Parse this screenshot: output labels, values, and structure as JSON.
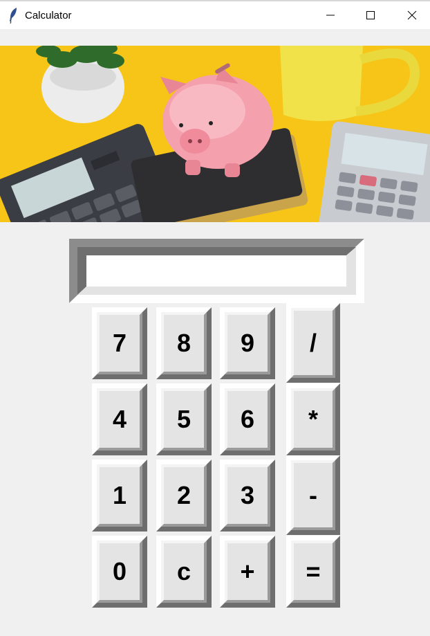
{
  "window": {
    "title": "Calculator",
    "controls": [
      "minimize",
      "maximize",
      "close"
    ]
  },
  "banner": {
    "alt": "piggy bank on notebook with calculators and plant",
    "colors": {
      "background": "#f7c518",
      "pig": "#f4a0ad",
      "mug": "#f1e24a"
    }
  },
  "display": {
    "value": ""
  },
  "keys": {
    "k7": "7",
    "k8": "8",
    "k9": "9",
    "div": "/",
    "k4": "4",
    "k5": "5",
    "k6": "6",
    "mul": "*",
    "k1": "1",
    "k2": "2",
    "k3": "3",
    "sub": "-",
    "k0": "0",
    "clr": "c",
    "add": "+",
    "eq": "="
  }
}
